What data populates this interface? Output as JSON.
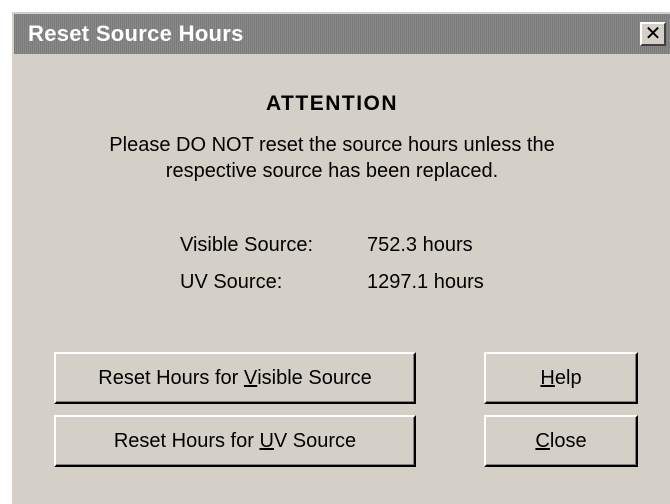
{
  "window": {
    "title": "Reset Source Hours",
    "close_glyph": "✕"
  },
  "content": {
    "heading": "ATTENTION",
    "warning_line1": "Please DO NOT reset the source hours unless the",
    "warning_line2": "respective source has been replaced."
  },
  "sources": [
    {
      "label": "Visible Source:",
      "value": "752.3 hours"
    },
    {
      "label": "UV Source:",
      "value": "1297.1 hours"
    }
  ],
  "buttons": {
    "reset_visible": {
      "before": "Reset Hours for ",
      "mnemonic": "V",
      "after": "isible Source"
    },
    "reset_uv": {
      "before": "Reset Hours for ",
      "mnemonic": "U",
      "after": "V Source"
    },
    "help": {
      "before": "",
      "mnemonic": "H",
      "after": "elp"
    },
    "close": {
      "before": "",
      "mnemonic": "C",
      "after": "lose"
    }
  }
}
